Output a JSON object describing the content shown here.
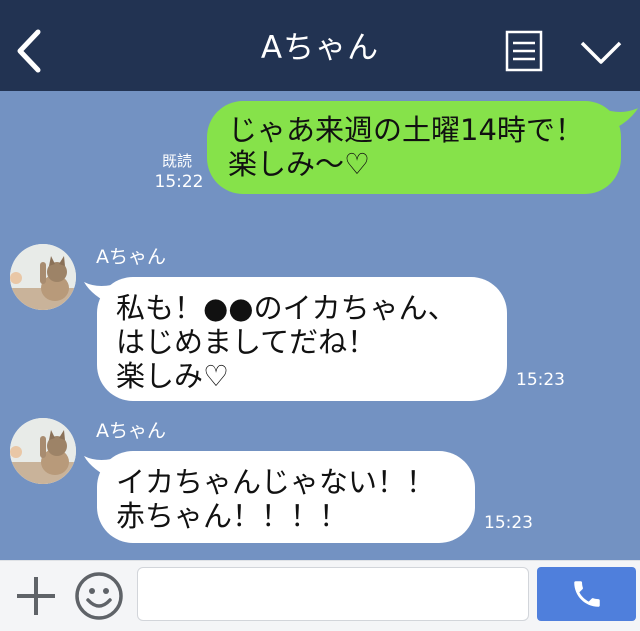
{
  "header": {
    "title": "Aちゃん",
    "back_icon": "chevron-left-icon",
    "notes_icon": "notes-icon",
    "menu_icon": "chevron-down-icon"
  },
  "messages": [
    {
      "from": "self",
      "text": "じゃあ来週の土曜14時で！\n楽しみ〜♡",
      "read_label": "既読",
      "time": "15:22"
    },
    {
      "from": "other",
      "sender": "Aちゃん",
      "text": "私も！●●のイカちゃん、\nはじめましてだね！\n楽しみ♡",
      "time": "15:23"
    },
    {
      "from": "other",
      "sender": "Aちゃん",
      "text": "イカちゃんじゃない！！\n赤ちゃん！！！！",
      "time": "15:23"
    }
  ],
  "footer": {
    "input_placeholder": "",
    "input_value": "",
    "plus_icon": "plus-icon",
    "emoji_icon": "smiley-icon",
    "call_icon": "phone-icon"
  },
  "colors": {
    "header_bg": "#223352",
    "chat_bg": "#7392c2",
    "self_bubble": "#86e24a",
    "other_bubble": "#ffffff",
    "call_button": "#4f7fdc"
  }
}
